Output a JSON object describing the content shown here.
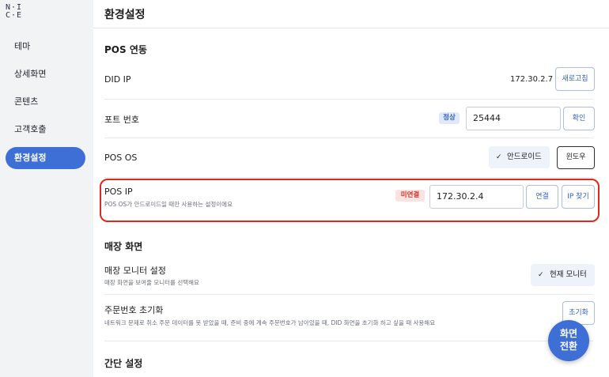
{
  "sidebar": {
    "logo_top": "N·I",
    "logo_bottom": "C·E",
    "items": [
      {
        "label": "테마"
      },
      {
        "label": "상세화면"
      },
      {
        "label": "콘텐츠"
      },
      {
        "label": "고객호출"
      },
      {
        "label": "환경설정",
        "active": true
      }
    ]
  },
  "header": {
    "title": "환경설정"
  },
  "pos_section": {
    "title": "POS 연동",
    "did_ip": {
      "label": "DID IP",
      "value": "172.30.2.7",
      "refresh_label": "새로고침"
    },
    "port": {
      "label": "포트 번호",
      "status": "정상",
      "value": "25444",
      "confirm_label": "확인"
    },
    "pos_os": {
      "label": "POS OS",
      "android_label": "안드로이드",
      "windows_label": "윈도우",
      "selected": "안드로이드"
    },
    "pos_ip": {
      "label": "POS IP",
      "description": "POS OS가 안드로이드일 때만 사용하는 설정이에요",
      "status": "미연결",
      "value": "172.30.2.4",
      "connect_label": "연결",
      "find_label": "IP 찾기"
    }
  },
  "store_section": {
    "title": "매장 화면",
    "monitor": {
      "label": "매장 모니터 설정",
      "description": "매장 화면을 보여줄 모니터를 선택해요",
      "current_label": "현재 모니터"
    },
    "order_reset": {
      "label": "주문번호 초기화",
      "description": "네트워크 문제로 취소 주문 데이터를 못 받았을 때, 준비 중에 계속 주문번호가 남아있을 때, DID 화면을 초기화 하고 싶을 때 사용해요",
      "reset_label": "초기화"
    }
  },
  "simple_section": {
    "title": "간단 설정"
  },
  "fab": {
    "line1": "화면",
    "line2": "전환"
  },
  "colors": {
    "accent": "#3d6fd6",
    "highlight": "#e3281b",
    "ok_badge": "#e1e9f8",
    "error_badge": "#fbe1df"
  }
}
